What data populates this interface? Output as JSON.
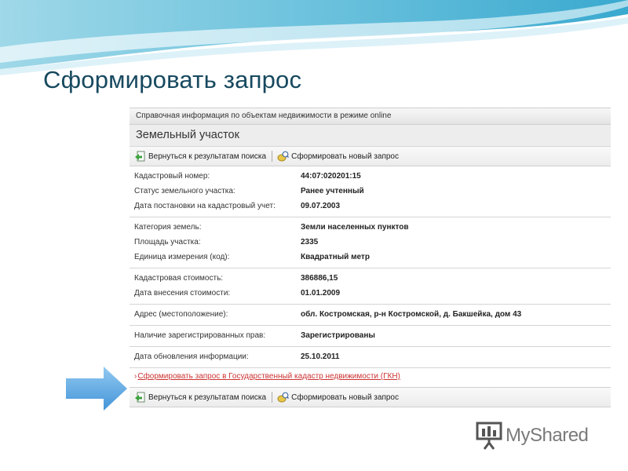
{
  "slide": {
    "title": "Сформировать запрос"
  },
  "panel": {
    "topbar_text": "Справочная информация по объектам недвижимости в режиме online",
    "heading": "Земельный участок",
    "toolbar_top": {
      "back_label": "Вернуться к результатам поиска",
      "new_request_label": "Сформировать новый запрос"
    },
    "groups": [
      {
        "rows": [
          {
            "label": "Кадастровый номер:",
            "value": "44:07:020201:15"
          },
          {
            "label": "Статус земельного участка:",
            "value": "Ранее учтенный"
          },
          {
            "label": "Дата постановки на кадастровый учет:",
            "value": "09.07.2003"
          }
        ]
      },
      {
        "rows": [
          {
            "label": "Категория земель:",
            "value": "Земли населенных пунктов"
          },
          {
            "label": "Площадь участка:",
            "value": "2335"
          },
          {
            "label": "Единица измерения (код):",
            "value": "Квадратный метр"
          }
        ]
      },
      {
        "rows": [
          {
            "label": "Кадастровая стоимость:",
            "value": "386886,15"
          },
          {
            "label": "Дата внесения стоимости:",
            "value": "01.01.2009"
          }
        ]
      },
      {
        "rows": [
          {
            "label": "Адрес (местоположение):",
            "value": "обл. Костромская, р-н Костромской, д. Бакшейка, дом 43"
          }
        ]
      },
      {
        "rows": [
          {
            "label": "Наличие зарегистрированных прав:",
            "value": "Зарегистрированы"
          }
        ]
      },
      {
        "rows": [
          {
            "label": "Дата обновления информации:",
            "value": "25.10.2011"
          }
        ]
      }
    ],
    "gkn_link": {
      "chevron": "›",
      "label": "Сформировать запрос в Государственный кадастр недвижимости (ГКН)"
    },
    "toolbar_bottom": {
      "back_label": "Вернуться к результатам поиска",
      "new_request_label": "Сформировать новый запрос"
    }
  },
  "logo": {
    "text": "MyShared"
  },
  "colors": {
    "title": "#17495f",
    "link": "#cc3333",
    "arrow": "#4a9ad8",
    "wave": "#5fb7d6"
  }
}
